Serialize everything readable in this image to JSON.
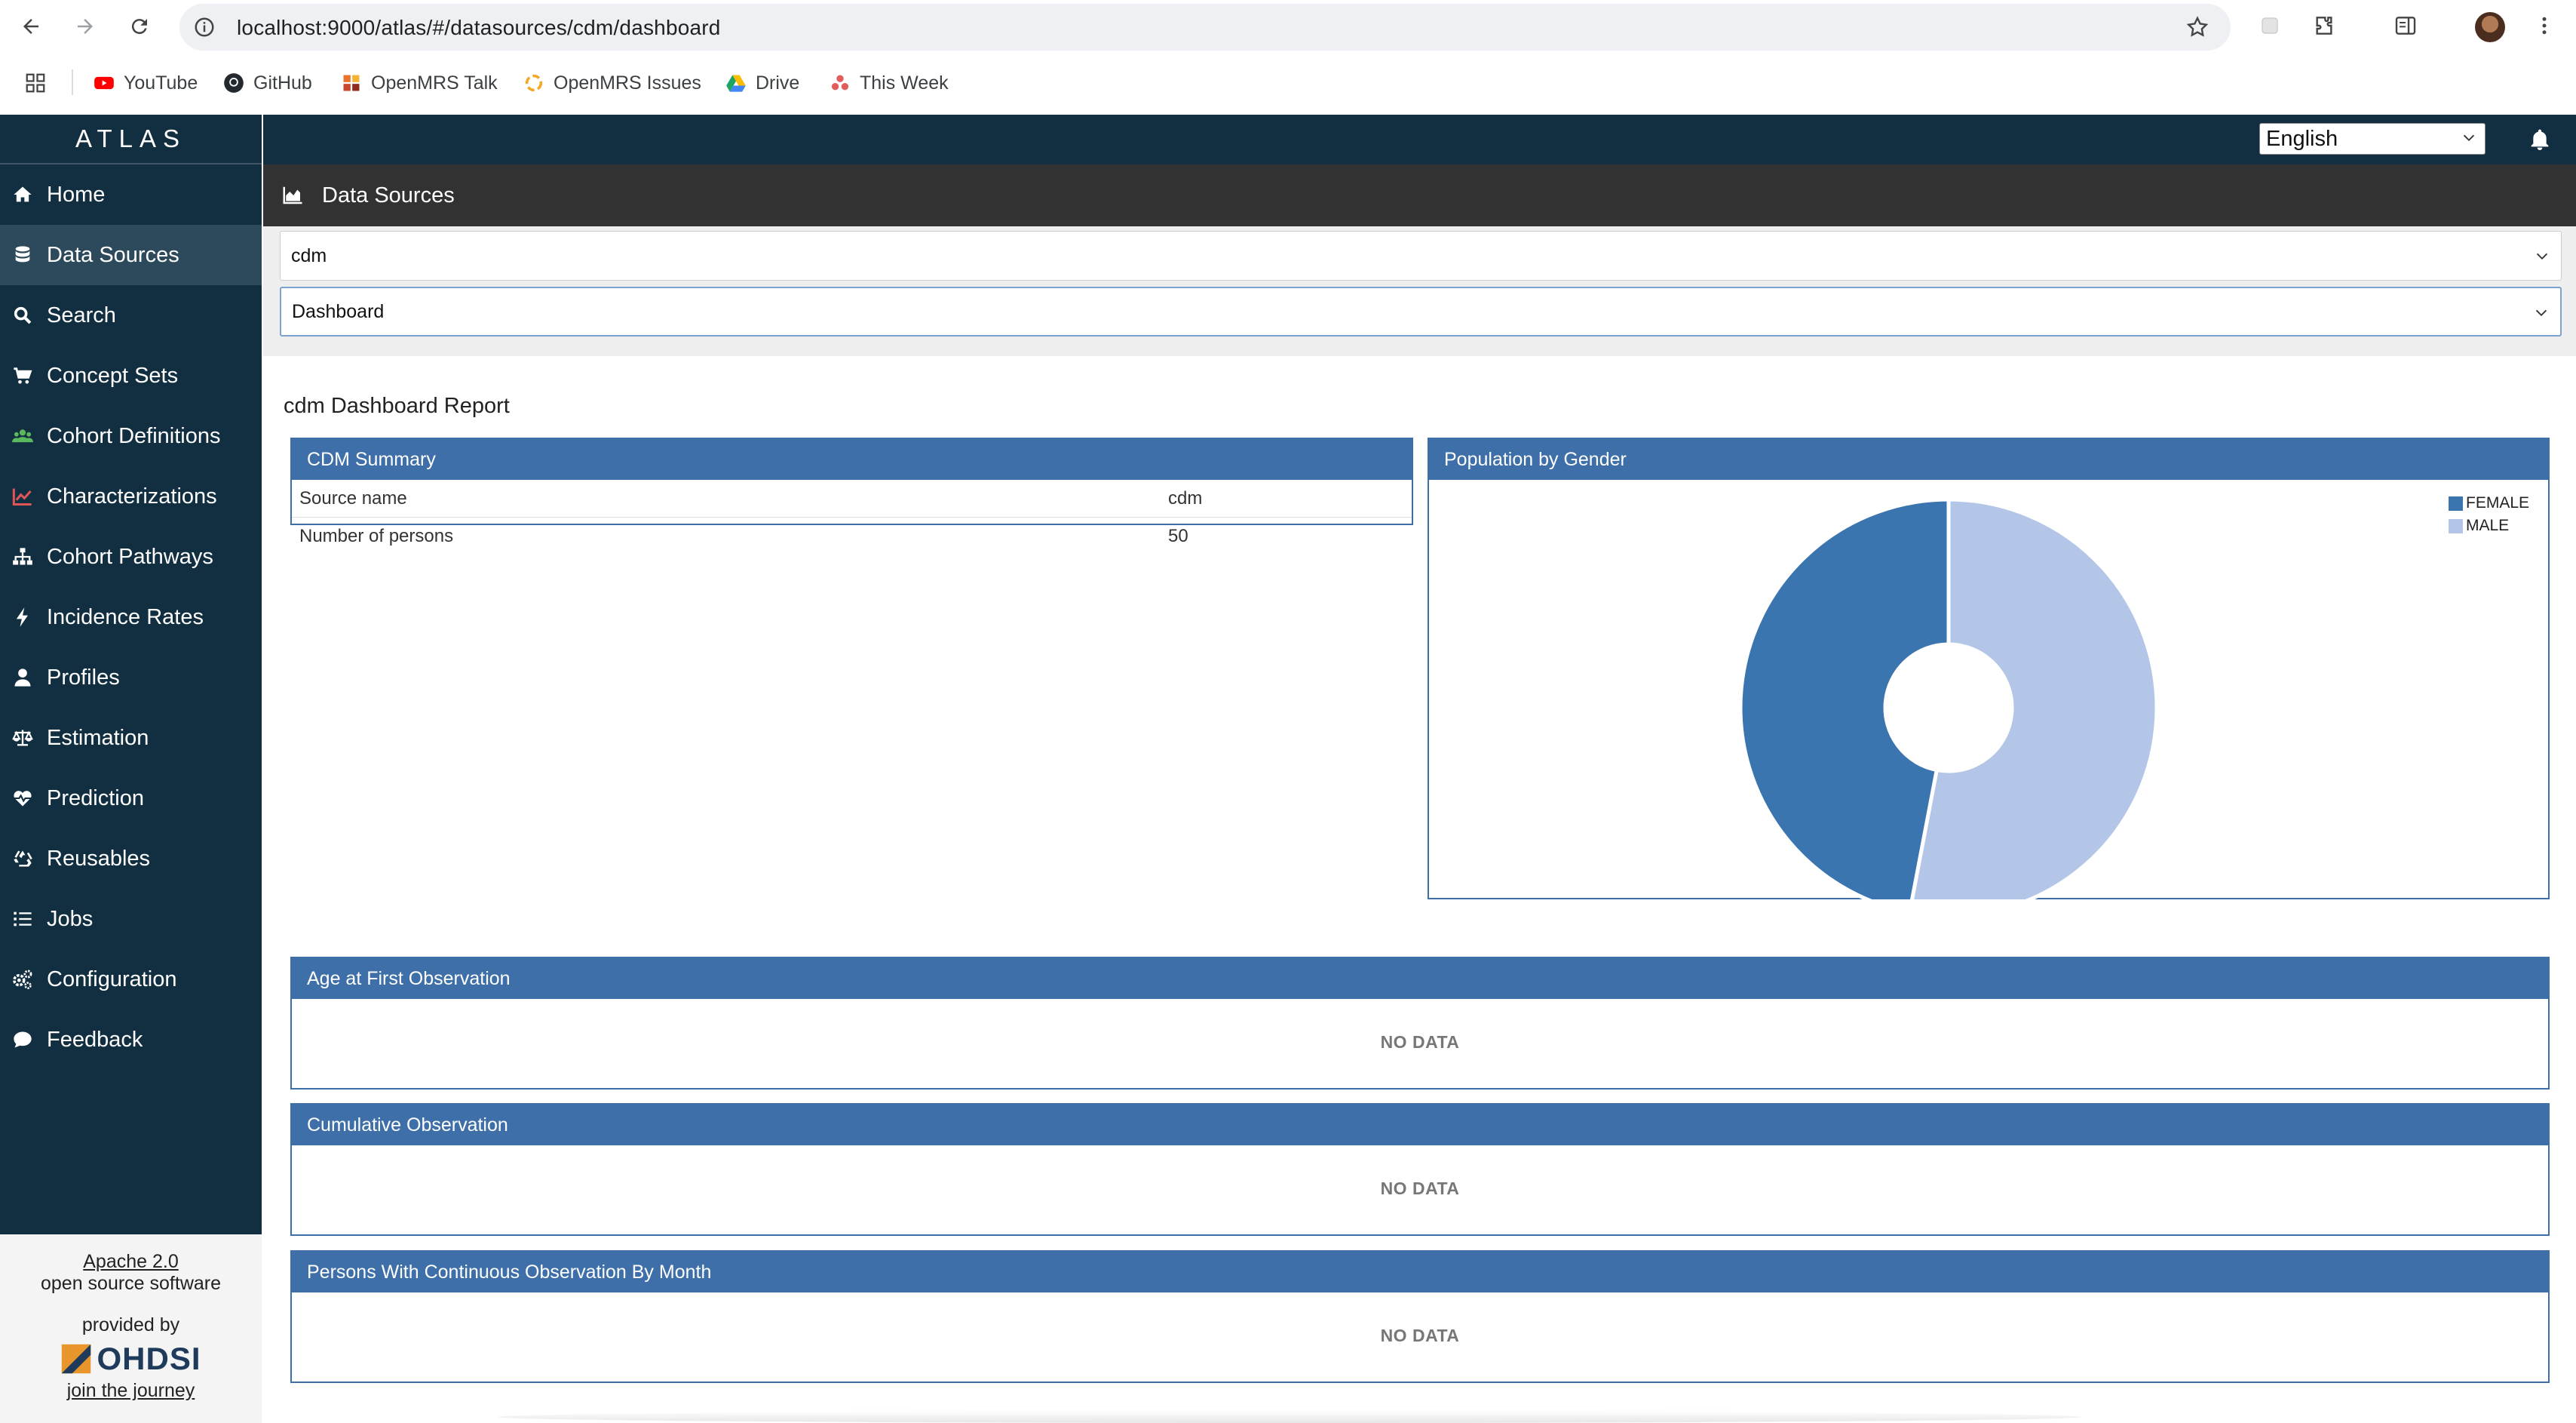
{
  "browser": {
    "url_host": "localhost",
    "url_path": ":9000/atlas/#/datasources/cdm/dashboard",
    "bookmarks": [
      {
        "label": "YouTube",
        "icon": "youtube-icon",
        "color": "#ff0000"
      },
      {
        "label": "GitHub",
        "icon": "github-icon",
        "color": "#24292f"
      },
      {
        "label": "OpenMRS Talk",
        "icon": "openmrs-talk-icon",
        "color": "#e8742c"
      },
      {
        "label": "OpenMRS Issues",
        "icon": "openmrs-issues-icon",
        "color": "#f5a623"
      },
      {
        "label": "Drive",
        "icon": "drive-icon",
        "color": "#1fa463"
      },
      {
        "label": "This Week",
        "icon": "this-week-icon",
        "color": "#e25c5c"
      }
    ]
  },
  "app": {
    "brand": "ATLAS",
    "language": "English",
    "sidebar": {
      "items": [
        {
          "label": "Home",
          "icon": "home-icon",
          "active": false
        },
        {
          "label": "Data Sources",
          "icon": "database-icon",
          "active": true
        },
        {
          "label": "Search",
          "icon": "search-icon",
          "active": false
        },
        {
          "label": "Concept Sets",
          "icon": "cart-icon",
          "active": false
        },
        {
          "label": "Cohort Definitions",
          "icon": "users-icon",
          "active": false
        },
        {
          "label": "Characterizations",
          "icon": "line-chart-icon",
          "active": false
        },
        {
          "label": "Cohort Pathways",
          "icon": "sitemap-icon",
          "active": false
        },
        {
          "label": "Incidence Rates",
          "icon": "bolt-icon",
          "active": false
        },
        {
          "label": "Profiles",
          "icon": "user-icon",
          "active": false
        },
        {
          "label": "Estimation",
          "icon": "balance-scale-icon",
          "active": false
        },
        {
          "label": "Prediction",
          "icon": "heartbeat-icon",
          "active": false
        },
        {
          "label": "Reusables",
          "icon": "recycle-icon",
          "active": false
        },
        {
          "label": "Jobs",
          "icon": "list-icon",
          "active": false
        },
        {
          "label": "Configuration",
          "icon": "cogs-icon",
          "active": false
        },
        {
          "label": "Feedback",
          "icon": "comment-icon",
          "active": false
        }
      ],
      "footer": {
        "license_link": "Apache 2.0",
        "license_text": "open source software",
        "provided_by": "provided by",
        "org": "OHDSI",
        "join_link": "join the journey"
      }
    },
    "page": {
      "title": "Data Sources",
      "source_select": "cdm",
      "report_select": "Dashboard",
      "report_title": "cdm Dashboard Report"
    },
    "summary": {
      "title": "CDM Summary",
      "rows": [
        {
          "key": "Source name",
          "value": "cdm"
        },
        {
          "key": "Number of persons",
          "value": "50"
        }
      ]
    },
    "panels": {
      "age": {
        "title": "Age at First Observation",
        "body": "NO DATA"
      },
      "cumulative": {
        "title": "Cumulative Observation",
        "body": "NO DATA"
      },
      "continuous": {
        "title": "Persons With Continuous Observation By Month",
        "body": "NO DATA"
      }
    }
  },
  "colors": {
    "sidebar": "#122e41",
    "panel_header": "#3e6fa8",
    "female": "#3a75b0",
    "male": "#b3c6e7"
  },
  "chart_data": {
    "type": "pie",
    "title": "Population by Gender",
    "donut": true,
    "legend_position": "top-right",
    "series": [
      {
        "name": "FEMALE",
        "value": 0.47,
        "color": "#3a75b0"
      },
      {
        "name": "MALE",
        "value": 0.53,
        "color": "#b3c6e7"
      }
    ]
  }
}
